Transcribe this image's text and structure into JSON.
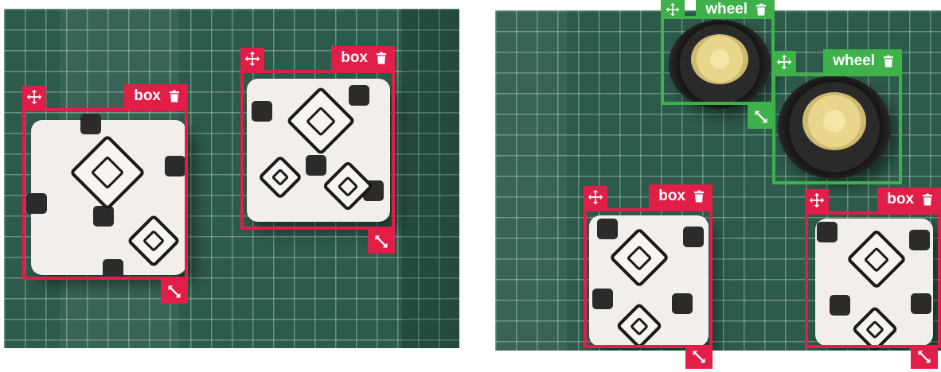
{
  "annotations": {
    "left_image": [
      {
        "label": "box",
        "color": "#e01e48"
      },
      {
        "label": "box",
        "color": "#e01e48"
      }
    ],
    "right_image": [
      {
        "label": "wheel",
        "color": "#3fb14a"
      },
      {
        "label": "wheel",
        "color": "#3fb14a"
      },
      {
        "label": "box",
        "color": "#e01e48"
      },
      {
        "label": "box",
        "color": "#e01e48"
      }
    ]
  },
  "icons": {
    "move": "move-icon",
    "delete": "trash-icon",
    "resize": "resize-icon"
  }
}
